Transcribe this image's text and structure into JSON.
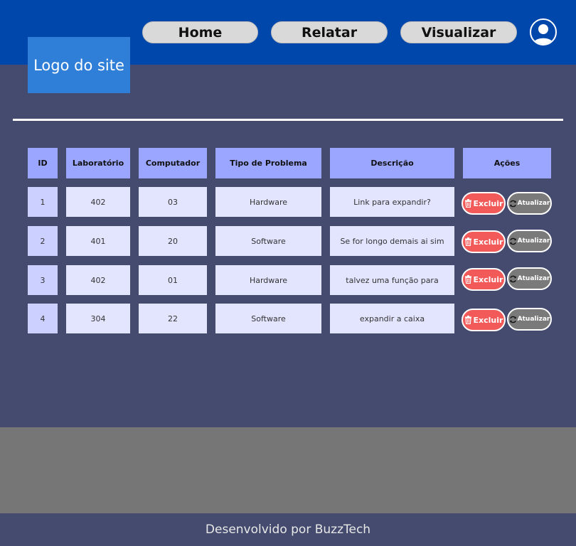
{
  "header": {
    "logo_text": "Logo do site",
    "nav": [
      "Home",
      "Relatar",
      "Visualizar"
    ]
  },
  "table": {
    "columns": [
      "ID",
      "Laboratório",
      "Computador",
      "Tipo de Problema",
      "Descrição",
      "Ações"
    ],
    "rows": [
      [
        "1",
        "402",
        "03",
        "Hardware",
        "Link para expandir?"
      ],
      [
        "2",
        "401",
        "20",
        "Software",
        "Se for longo demais ai sim"
      ],
      [
        "3",
        "402",
        "01",
        "Hardware",
        "talvez uma função para"
      ],
      [
        "4",
        "304",
        "22",
        "Software",
        "expandir a caixa"
      ]
    ],
    "actions": {
      "delete_label": "Excluir",
      "update_label": "Atualizar"
    }
  },
  "footer": {
    "text": "Desenvolvido por BuzzTech"
  },
  "icons": {
    "profile": "user-icon",
    "delete": "trash-icon",
    "update": "refresh-icon"
  },
  "colors": {
    "header_bg": "#0047ab",
    "logo_bg": "#2f7ed8",
    "page_bg": "#444b6e",
    "table_header_bg": "#9aa6ff",
    "cell_bg": "#e3e5ff",
    "id_cell_bg": "#ccd0ff",
    "delete_btn": "#f25a5a",
    "update_btn": "#7a7a7a",
    "gray_band": "#767676"
  }
}
